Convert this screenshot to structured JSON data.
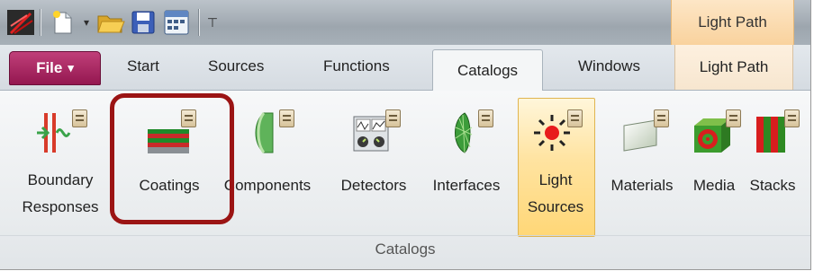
{
  "quick_access": {
    "icons": [
      "app-logo-icon",
      "new-document-icon",
      "dropdown-arrow-icon",
      "open-folder-icon",
      "save-icon",
      "calendar-icon",
      "customize-toolbar-icon"
    ],
    "context_header": "Light Path"
  },
  "tabs": {
    "file": "File",
    "file_arrow": "▾",
    "start": "Start",
    "sources": "Sources",
    "functions": "Functions",
    "catalogs": "Catalogs",
    "windows": "Windows",
    "light_path": "Light Path"
  },
  "ribbon": {
    "group_label": "Catalogs",
    "items": [
      {
        "label_line1": "Boundary",
        "label_line2": "Responses"
      },
      {
        "label_line1": "Coatings"
      },
      {
        "label_line1": "Components"
      },
      {
        "label_line1": "Detectors"
      },
      {
        "label_line1": "Interfaces"
      },
      {
        "label_line1": "Light",
        "label_line2": "Sources"
      },
      {
        "label_line1": "Materials"
      },
      {
        "label_line1": "Media"
      },
      {
        "label_line1": "Stacks"
      }
    ]
  },
  "colors": {
    "file_tab": "#a8245f",
    "context_tab": "#f9d6a6",
    "highlight_box": "#9b1414",
    "selected_item": "#ffdf8a"
  }
}
